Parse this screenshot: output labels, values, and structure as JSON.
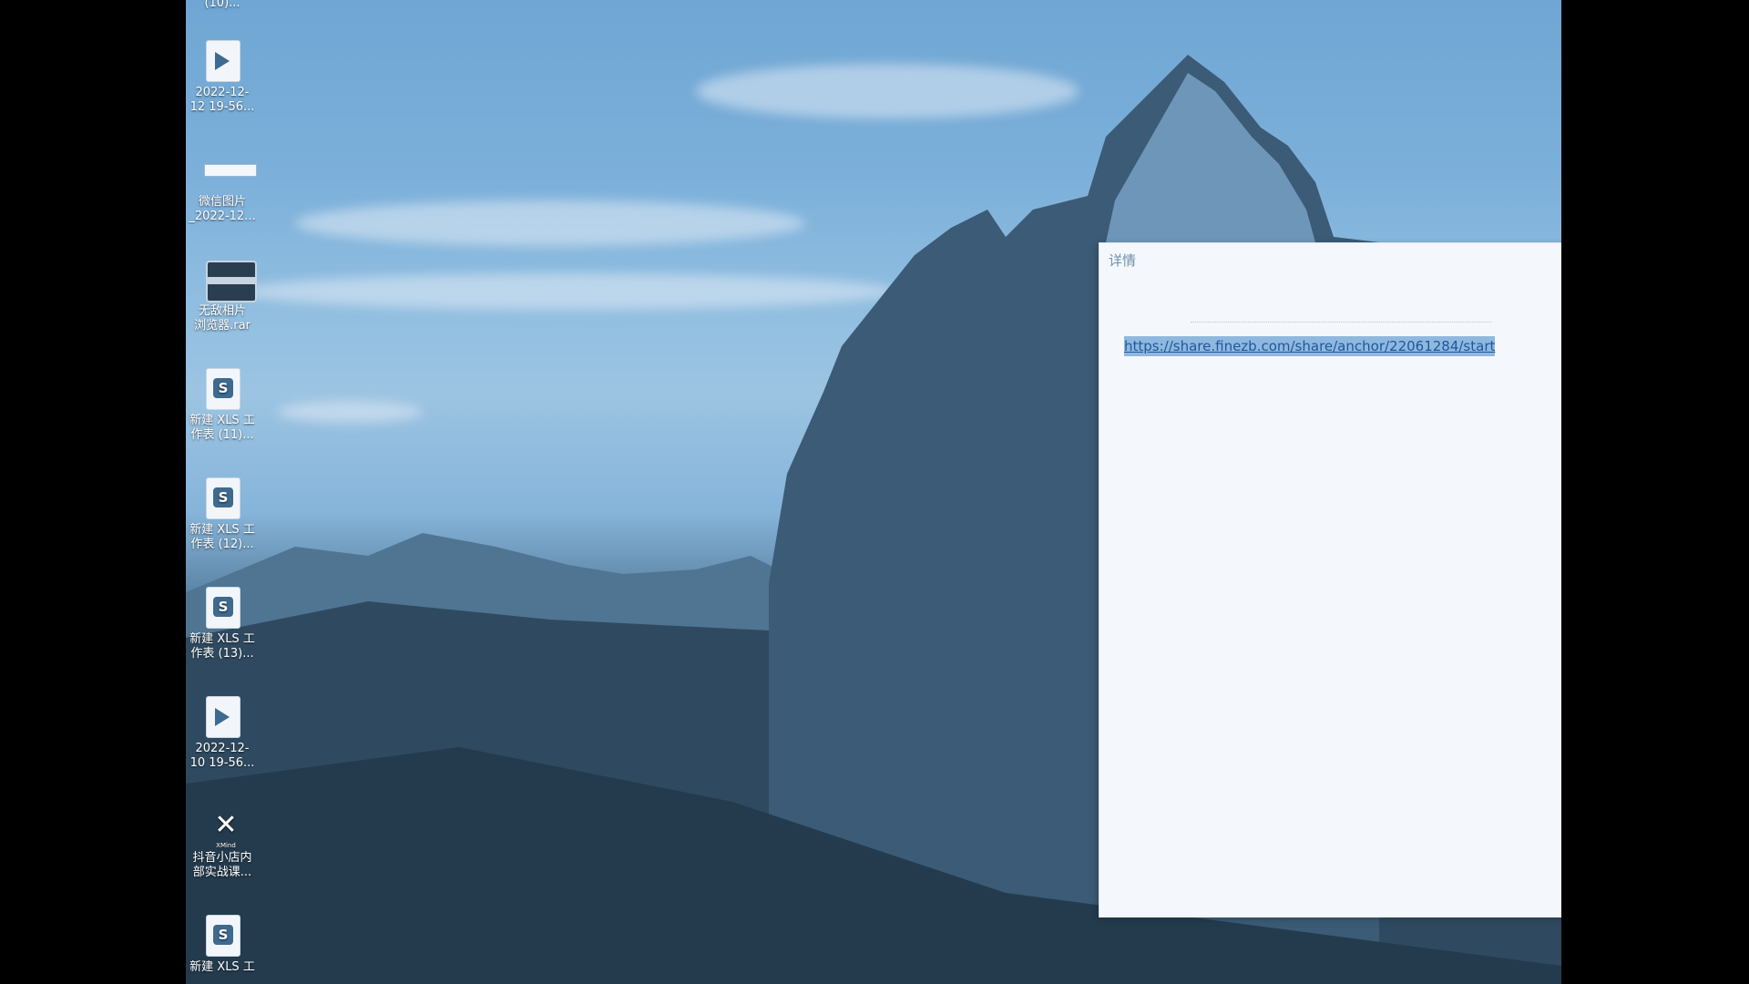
{
  "desktop": {
    "icons": [
      {
        "type": "video",
        "label": "2022-12-\n12 19-56..."
      },
      {
        "type": "image",
        "label": "微信图片\n_2022-12..."
      },
      {
        "type": "rar",
        "label": "无敌相片\n浏览器.rar"
      },
      {
        "type": "xls",
        "label": "新建 XLS 工\n作表 (11)..."
      },
      {
        "type": "xls",
        "label": "新建 XLS 工\n作表 (12)..."
      },
      {
        "type": "xls",
        "label": "新建 XLS 工\n作表 (13)..."
      },
      {
        "type": "video",
        "label": "2022-12-\n10 19-56..."
      },
      {
        "type": "xmind",
        "label": "抖音小店内\n部实战课..."
      },
      {
        "type": "xls",
        "label": "新建 XLS 工"
      }
    ],
    "top_partial_label": "(10)...",
    "xls_mark": "S",
    "xmind_mark": "XMind"
  },
  "details_window": {
    "title": "详情",
    "link": "https://share.finezb.com/share/anchor/22061284/start"
  },
  "colors": {
    "window_bg": "#f4f7fb",
    "link": "#1e57a0",
    "selection": "#8fb8de",
    "title": "#6f8fab"
  }
}
